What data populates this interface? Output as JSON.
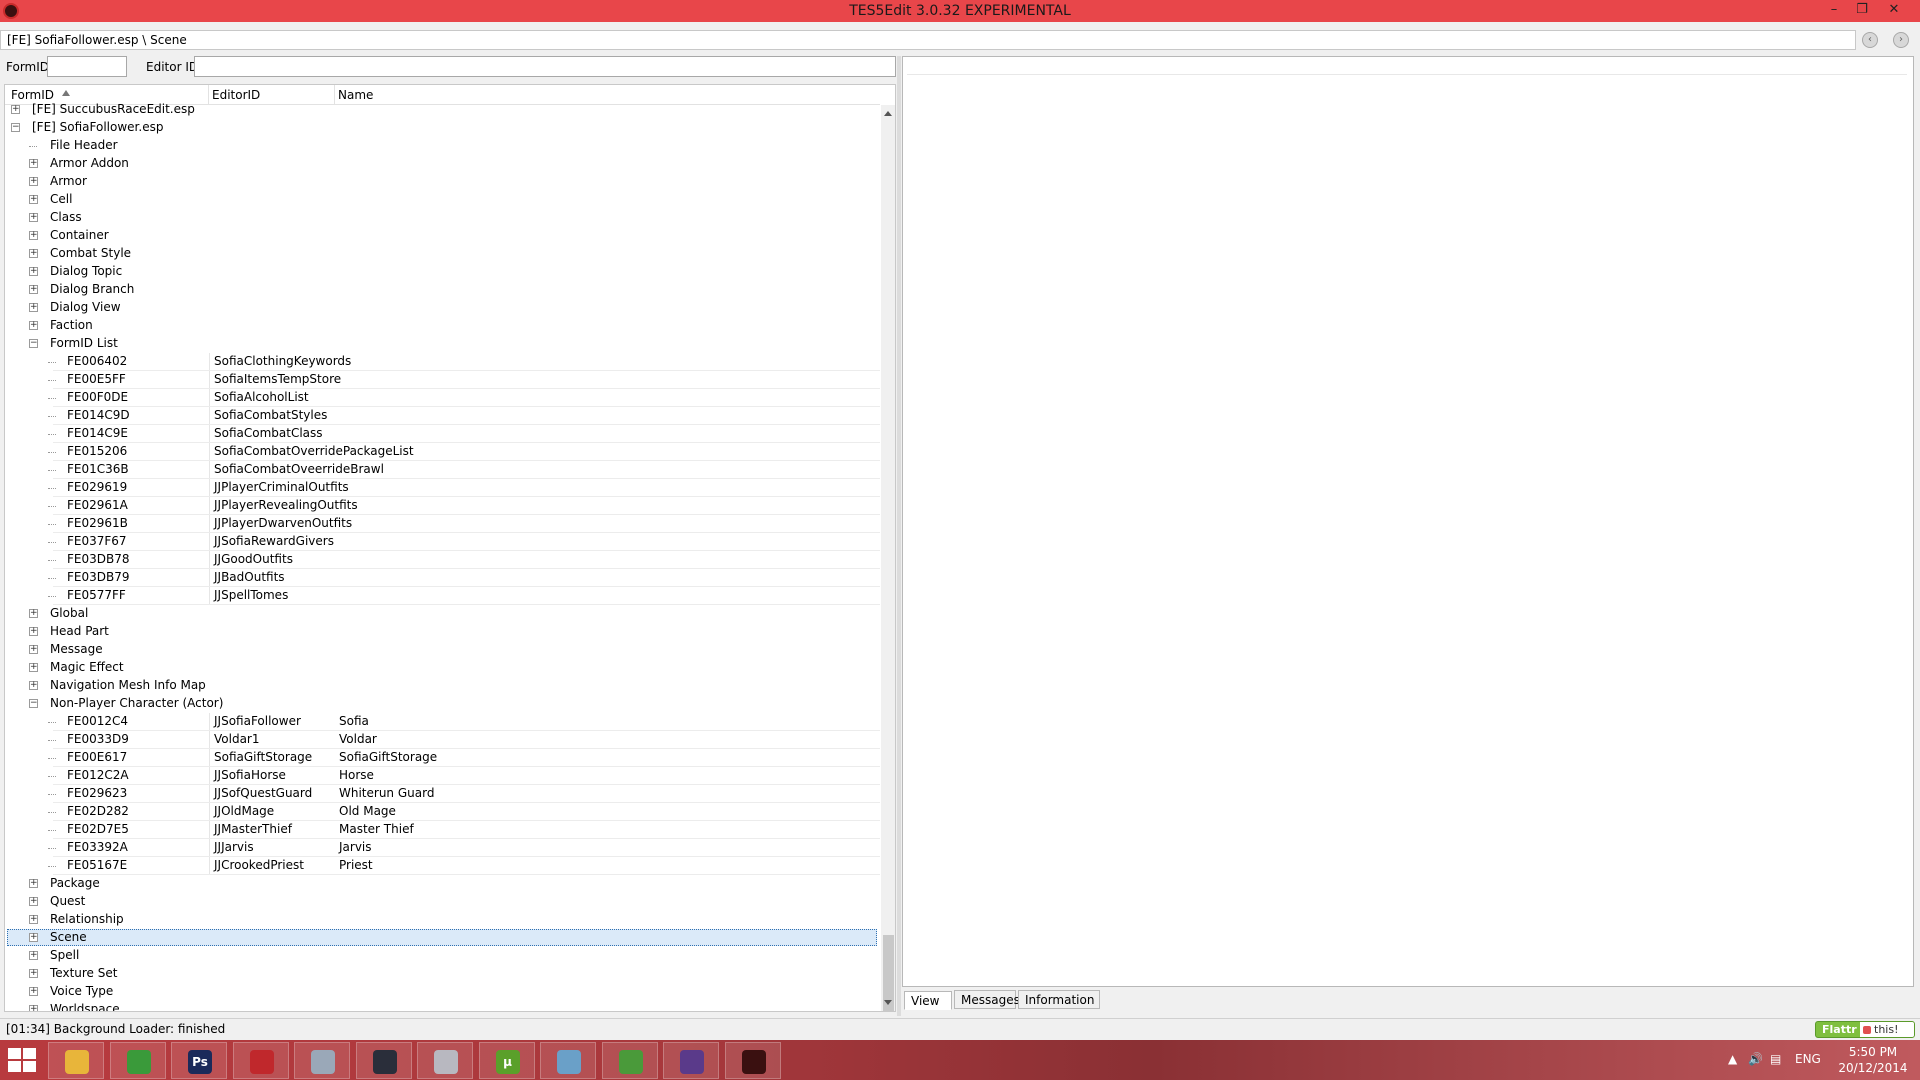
{
  "window": {
    "title": "TES5Edit 3.0.32 EXPERIMENTAL",
    "minimize_glyph": "–",
    "maximize_glyph": "❐",
    "close_glyph": "✕"
  },
  "pathbar": {
    "text": "[FE] SofiaFollower.esp \\ Scene"
  },
  "filters": {
    "formid_label": "FormID",
    "editorid_label": "Editor ID",
    "formid_value": "",
    "editorid_value": ""
  },
  "tree": {
    "columns": {
      "formid": "FormID",
      "editorid": "EditorID",
      "name": "Name"
    },
    "plugin_partial": "[FE] SuccubusRaceEdit.esp",
    "plugin": "[FE] SofiaFollower.esp",
    "groups_top": [
      "File Header",
      "Armor Addon",
      "Armor",
      "Cell",
      "Class",
      "Container",
      "Combat Style",
      "Dialog Topic",
      "Dialog Branch",
      "Dialog View",
      "Faction"
    ],
    "formid_list_label": "FormID List",
    "formid_list_records": [
      {
        "id": "FE006402",
        "editor": "SofiaClothingKeywords"
      },
      {
        "id": "FE00E5FF",
        "editor": "SofiaItemsTempStore"
      },
      {
        "id": "FE00F0DE",
        "editor": "SofiaAlcoholList"
      },
      {
        "id": "FE014C9D",
        "editor": "SofiaCombatStyles"
      },
      {
        "id": "FE014C9E",
        "editor": "SofiaCombatClass"
      },
      {
        "id": "FE015206",
        "editor": "SofiaCombatOverridePackageList"
      },
      {
        "id": "FE01C36B",
        "editor": "SofiaCombatOveerrideBrawl"
      },
      {
        "id": "FE029619",
        "editor": "JJPlayerCriminalOutfits"
      },
      {
        "id": "FE02961A",
        "editor": "JJPlayerRevealingOutfits"
      },
      {
        "id": "FE02961B",
        "editor": "JJPlayerDwarvenOutfits"
      },
      {
        "id": "FE037F67",
        "editor": "JJSofiaRewardGivers"
      },
      {
        "id": "FE03DB78",
        "editor": "JJGoodOutfits"
      },
      {
        "id": "FE03DB79",
        "editor": "JJBadOutfits"
      },
      {
        "id": "FE0577FF",
        "editor": "JJSpellTomes"
      }
    ],
    "groups_mid": [
      "Global",
      "Head Part",
      "Message",
      "Magic Effect",
      "Navigation Mesh Info Map"
    ],
    "npc_label": "Non-Player Character (Actor)",
    "npc_records": [
      {
        "id": "FE0012C4",
        "editor": "JJSofiaFollower",
        "name": "Sofia"
      },
      {
        "id": "FE0033D9",
        "editor": "Voldar1",
        "name": "Voldar"
      },
      {
        "id": "FE00E617",
        "editor": "SofiaGiftStorage",
        "name": "SofiaGiftStorage"
      },
      {
        "id": "FE012C2A",
        "editor": "JJSofiaHorse",
        "name": "Horse"
      },
      {
        "id": "FE029623",
        "editor": "JJSofQuestGuard",
        "name": "Whiterun Guard"
      },
      {
        "id": "FE02D282",
        "editor": "JJOldMage",
        "name": "Old Mage"
      },
      {
        "id": "FE02D7E5",
        "editor": "JJMasterThief",
        "name": "Master Thief"
      },
      {
        "id": "FE03392A",
        "editor": "JJJarvis",
        "name": "Jarvis"
      },
      {
        "id": "FE05167E",
        "editor": "JJCrookedPriest",
        "name": "Priest"
      }
    ],
    "groups_bottom": [
      "Package",
      "Quest",
      "Relationship",
      "Scene",
      "Spell",
      "Texture Set",
      "Voice Type",
      "Worldspace"
    ],
    "selected_group": "Scene"
  },
  "tabs": [
    "View",
    "Messages",
    "Information"
  ],
  "active_tab": "View",
  "status": {
    "text": "[01:34] Background Loader: finished",
    "flattr_left": "Flattr",
    "flattr_right": "this!"
  },
  "taskbar": {
    "apps": [
      {
        "icon": "file-explorer-icon",
        "glyph": "",
        "color": "#e8b53a"
      },
      {
        "icon": "chrome-icon",
        "glyph": "",
        "color": "#3a9a3a"
      },
      {
        "icon": "photoshop-icon",
        "glyph": "Ps",
        "color": "#1b2a5a"
      },
      {
        "icon": "anki-icon",
        "glyph": "",
        "color": "#c0282c"
      },
      {
        "icon": "printer-icon",
        "glyph": "",
        "color": "#9aa8b8"
      },
      {
        "icon": "steam-icon",
        "glyph": "",
        "color": "#2a2e3a"
      },
      {
        "icon": "disc-icon",
        "glyph": "",
        "color": "#b8b8c0"
      },
      {
        "icon": "utorrent-icon",
        "glyph": "µ",
        "color": "#5aa02a"
      },
      {
        "icon": "notes-icon",
        "glyph": "",
        "color": "#6aa0c8"
      },
      {
        "icon": "chart-app-icon",
        "glyph": "",
        "color": "#4a9a3a"
      },
      {
        "icon": "winrar-icon",
        "glyph": "",
        "color": "#5a3a8a"
      },
      {
        "icon": "tes5edit-icon",
        "glyph": "",
        "color": "#3a1010"
      }
    ],
    "language": "ENG",
    "time": "5:50 PM",
    "date": "20/12/2014"
  }
}
